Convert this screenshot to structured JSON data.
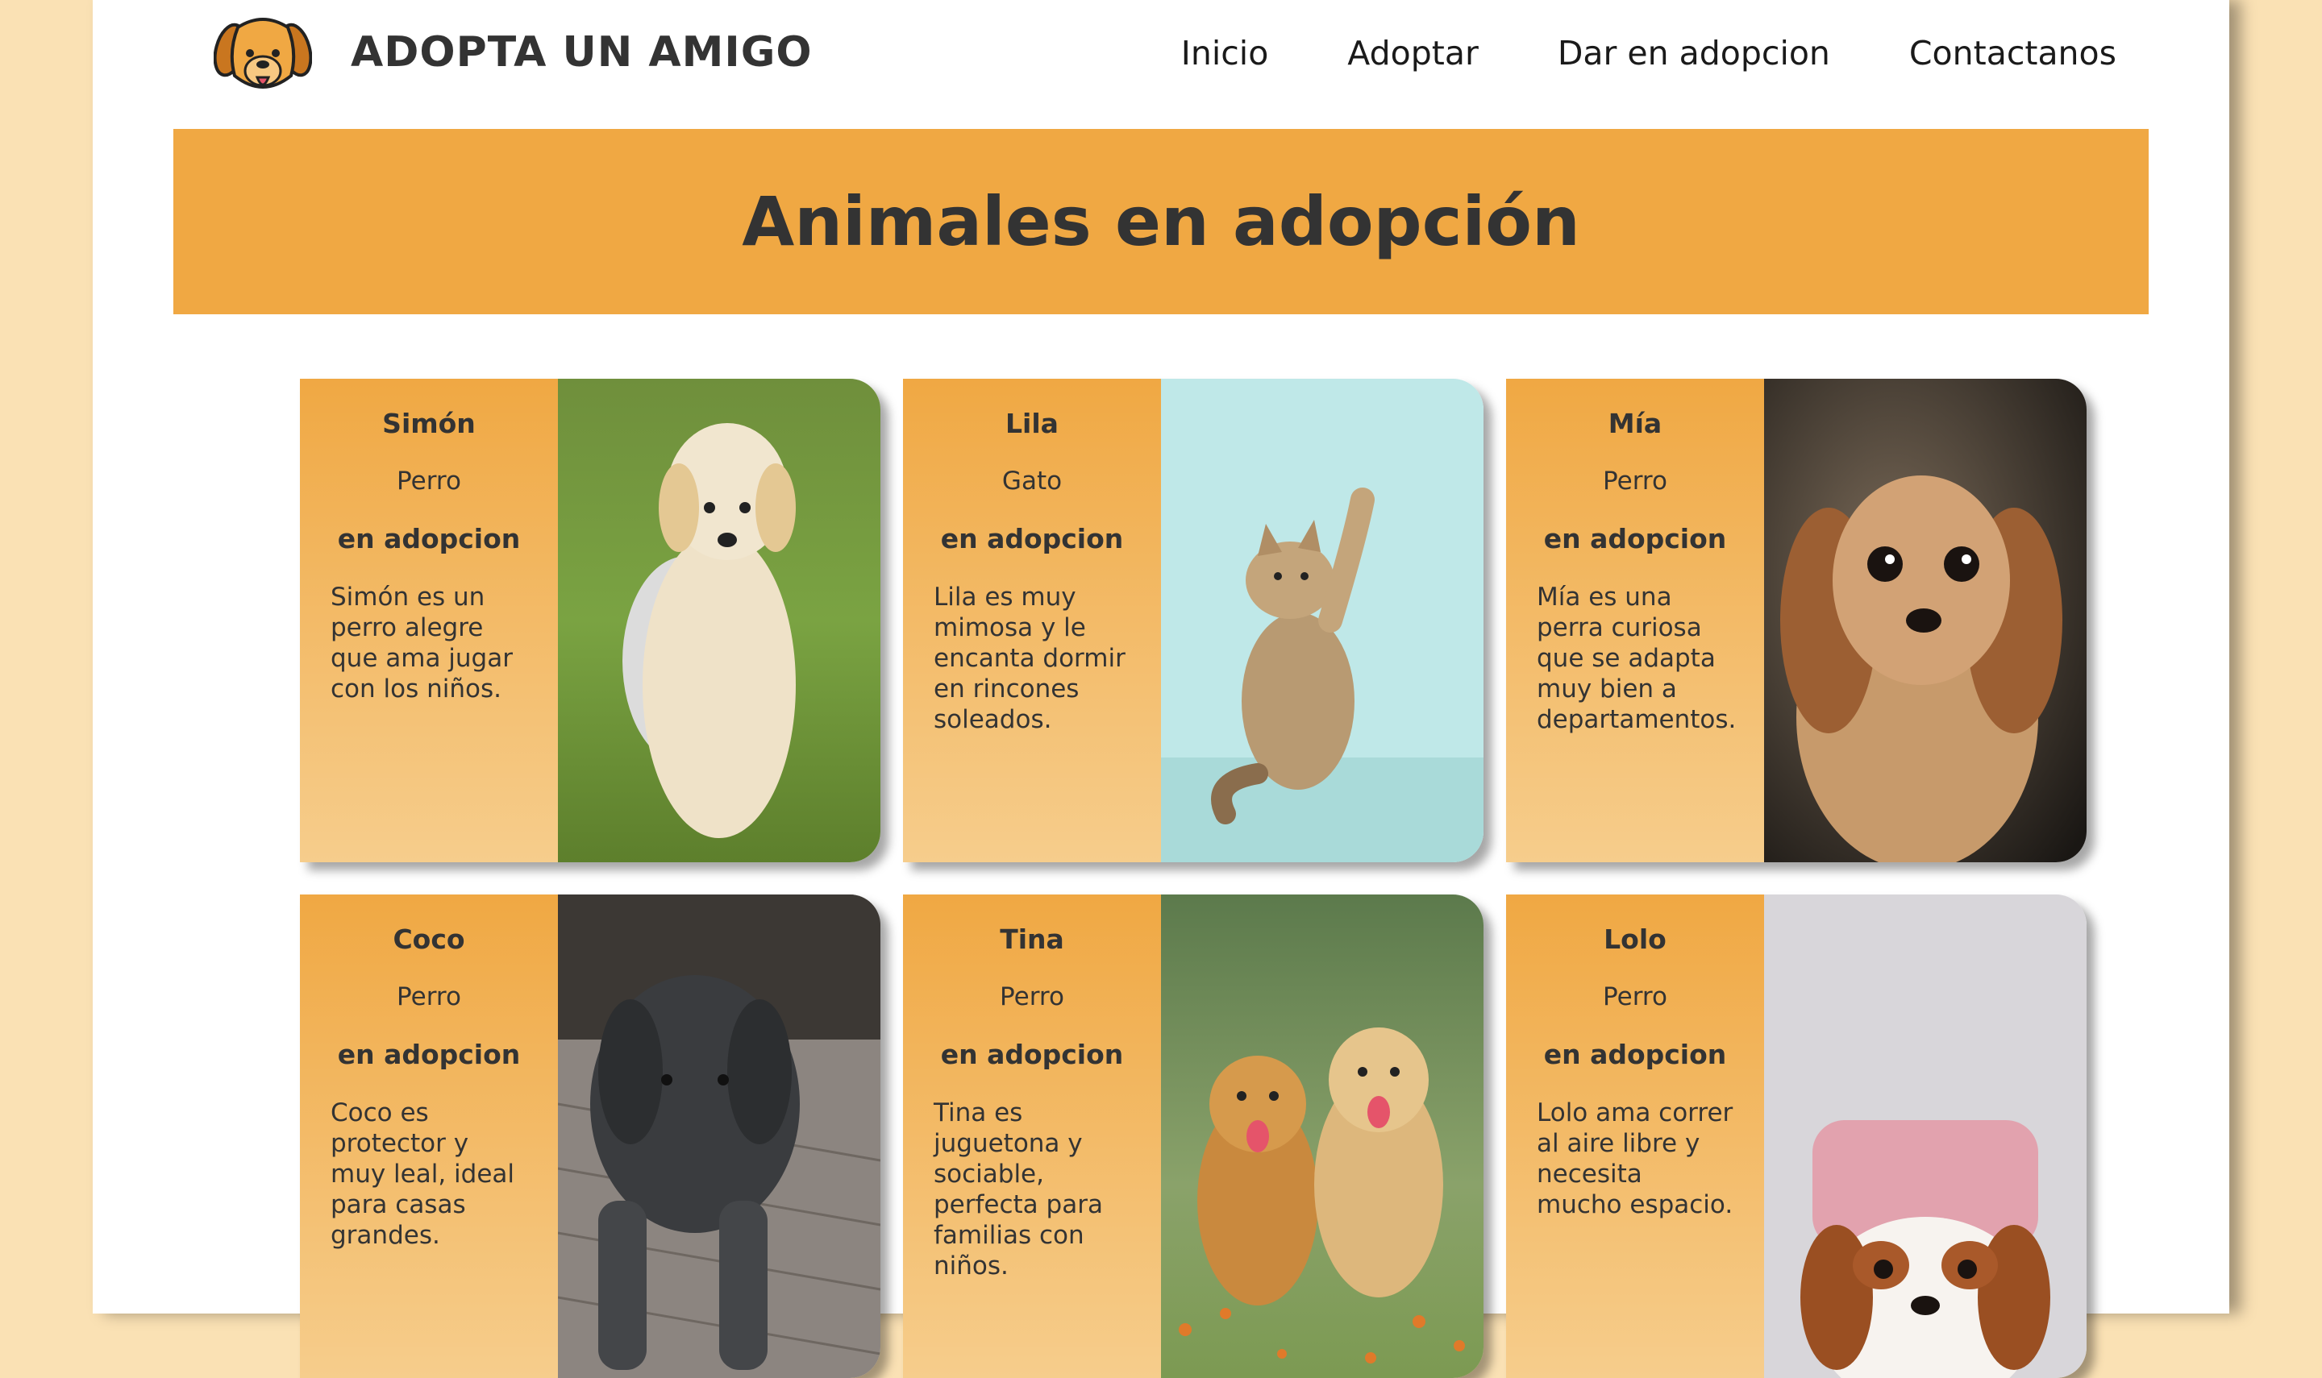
{
  "header": {
    "brand": "ADOPTA UN AMIGO",
    "logo_icon": "dog-face-icon",
    "nav": [
      "Inicio",
      "Adoptar",
      "Dar en adopcion",
      "Contactanos"
    ]
  },
  "banner": {
    "title": "Animales en adopción"
  },
  "colors": {
    "accent": "#f0a843",
    "background": "#fae1b4",
    "text": "#333333"
  },
  "animals": [
    {
      "name": "Simón",
      "species": "Perro",
      "status": "en adopcion",
      "description": "Simón es un perro alegre que ama jugar con los niños.",
      "photo": "golden-puppy-in-bowl-photo"
    },
    {
      "name": "Lila",
      "species": "Gato",
      "status": "en adopcion",
      "description": "Lila es muy mimosa y le encanta dormir en rincones soleados.",
      "photo": "kitten-raising-paw-photo"
    },
    {
      "name": "Mía",
      "species": "Perro",
      "status": "en adopcion",
      "description": "Mía es una perra curiosa que se adapta muy bien a departamentos.",
      "photo": "fluffy-brown-puppy-photo"
    },
    {
      "name": "Coco",
      "species": "Perro",
      "status": "en adopcion",
      "description": "Coco es protector y muy leal, ideal para casas grandes.",
      "photo": "gray-dog-lying-photo"
    },
    {
      "name": "Tina",
      "species": "Perro",
      "status": "en adopcion",
      "description": "Tina es juguetona y sociable, perfecta para familias con niños.",
      "photo": "two-golden-puppies-photo"
    },
    {
      "name": "Lolo",
      "species": "Perro",
      "status": "en adopcion",
      "description": "Lolo ama correr al aire libre y necesita mucho espacio.",
      "photo": "cavalier-puppy-photo"
    }
  ]
}
